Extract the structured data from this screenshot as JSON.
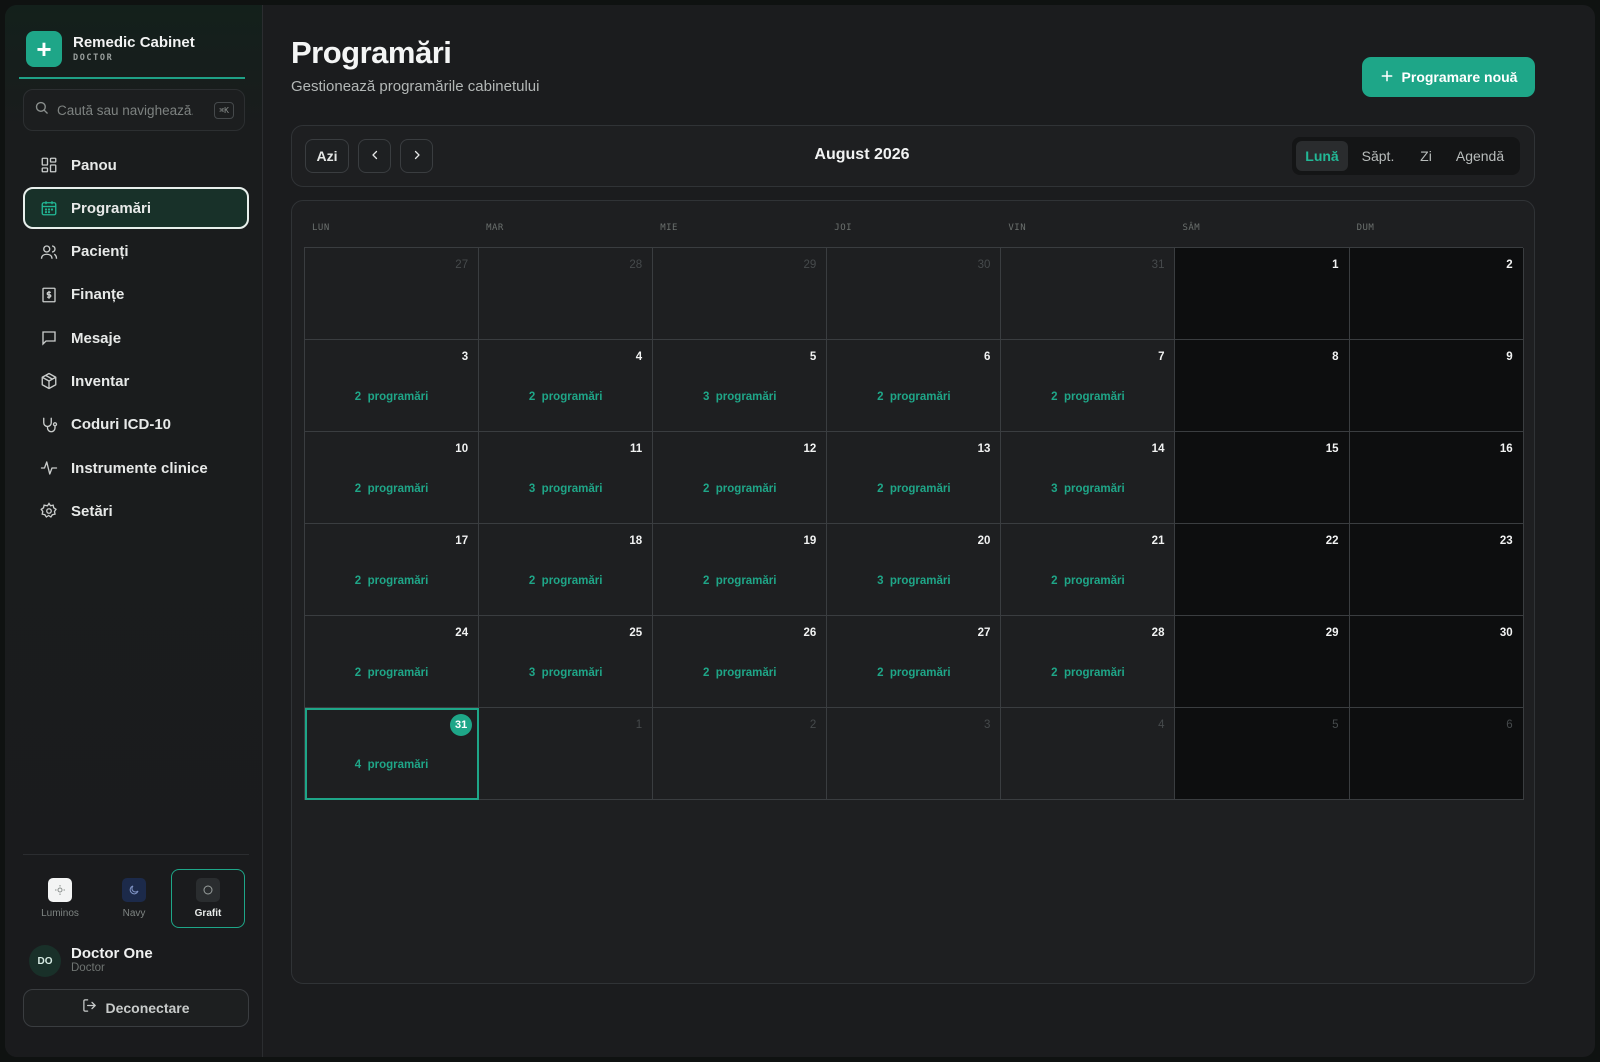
{
  "brand": {
    "name": "Remedic Cabinet",
    "role": "DOCTOR",
    "logo_icon": "plus-icon"
  },
  "search": {
    "placeholder": "Caută sau navighează...",
    "shortcut": "⌘K"
  },
  "nav": [
    {
      "label": "Panou",
      "icon": "dashboard-icon",
      "active": false
    },
    {
      "label": "Programări",
      "icon": "calendar-icon",
      "active": true
    },
    {
      "label": "Pacienți",
      "icon": "users-icon",
      "active": false
    },
    {
      "label": "Finanțe",
      "icon": "dollar-icon",
      "active": false
    },
    {
      "label": "Mesaje",
      "icon": "message-icon",
      "active": false
    },
    {
      "label": "Inventar",
      "icon": "box-icon",
      "active": false
    },
    {
      "label": "Coduri ICD-10",
      "icon": "stethoscope-icon",
      "active": false
    },
    {
      "label": "Instrumente clinice",
      "icon": "activity-icon",
      "active": false
    },
    {
      "label": "Setări",
      "icon": "gear-icon",
      "active": false
    }
  ],
  "themes": [
    {
      "label": "Luminos",
      "icon": "sun-icon",
      "active": false
    },
    {
      "label": "Navy",
      "icon": "moon-icon",
      "active": false
    },
    {
      "label": "Grafit",
      "icon": "circle-icon",
      "active": true
    }
  ],
  "user": {
    "initials": "DO",
    "name": "Doctor One",
    "role": "Doctor"
  },
  "logout": {
    "label": "Deconectare"
  },
  "page": {
    "title": "Programări",
    "subtitle": "Gestionează programările cabinetului"
  },
  "new_button": {
    "label": "Programare nouă"
  },
  "toolbar": {
    "today_label": "Azi",
    "month_title": "August 2026",
    "views": [
      {
        "label": "Lună",
        "active": true
      },
      {
        "label": "Săpt.",
        "active": false
      },
      {
        "label": "Zi",
        "active": false
      },
      {
        "label": "Agendă",
        "active": false
      }
    ]
  },
  "calendar": {
    "day_headers": [
      "LUN",
      "MAR",
      "MIE",
      "JOI",
      "VIN",
      "SÂM",
      "DUM"
    ],
    "appt_suffix": "programări",
    "weeks": [
      [
        {
          "day": "27",
          "other": true
        },
        {
          "day": "28",
          "other": true
        },
        {
          "day": "29",
          "other": true
        },
        {
          "day": "30",
          "other": true
        },
        {
          "day": "31",
          "other": true
        },
        {
          "day": "1"
        },
        {
          "day": "2"
        }
      ],
      [
        {
          "day": "3",
          "count": "2"
        },
        {
          "day": "4",
          "count": "2"
        },
        {
          "day": "5",
          "count": "3"
        },
        {
          "day": "6",
          "count": "2"
        },
        {
          "day": "7",
          "count": "2"
        },
        {
          "day": "8"
        },
        {
          "day": "9"
        }
      ],
      [
        {
          "day": "10",
          "count": "2"
        },
        {
          "day": "11",
          "count": "3"
        },
        {
          "day": "12",
          "count": "2"
        },
        {
          "day": "13",
          "count": "2"
        },
        {
          "day": "14",
          "count": "3"
        },
        {
          "day": "15"
        },
        {
          "day": "16"
        }
      ],
      [
        {
          "day": "17",
          "count": "2"
        },
        {
          "day": "18",
          "count": "2"
        },
        {
          "day": "19",
          "count": "2"
        },
        {
          "day": "20",
          "count": "3"
        },
        {
          "day": "21",
          "count": "2"
        },
        {
          "day": "22"
        },
        {
          "day": "23"
        }
      ],
      [
        {
          "day": "24",
          "count": "2"
        },
        {
          "day": "25",
          "count": "3"
        },
        {
          "day": "26",
          "count": "2"
        },
        {
          "day": "27",
          "count": "2"
        },
        {
          "day": "28",
          "count": "2"
        },
        {
          "day": "29"
        },
        {
          "day": "30"
        }
      ],
      [
        {
          "day": "31",
          "count": "4",
          "today": true
        },
        {
          "day": "1",
          "other": true
        },
        {
          "day": "2",
          "other": true
        },
        {
          "day": "3",
          "other": true
        },
        {
          "day": "4",
          "other": true
        },
        {
          "day": "5",
          "other": true
        },
        {
          "day": "6",
          "other": true
        }
      ]
    ]
  },
  "colors": {
    "accent": "#1ea688",
    "background": "#1b1c1e",
    "weekend": "#0d0e0f",
    "text": "#e6e8e7"
  }
}
